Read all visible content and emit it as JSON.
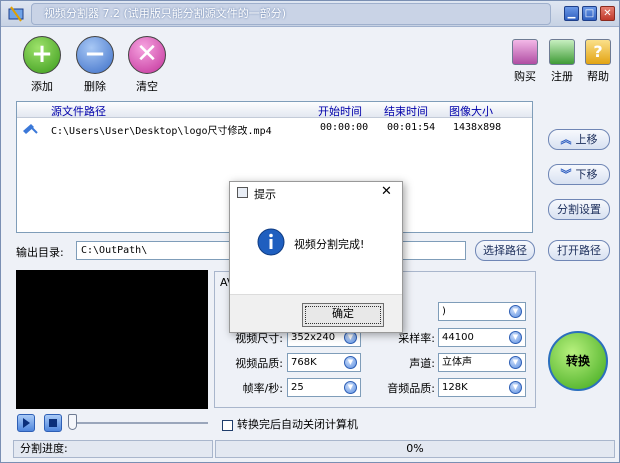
{
  "window": {
    "title": "视频分割器 7.2 (试用版只能分割源文件的一部分)"
  },
  "toolbar": {
    "add_label": "添加",
    "delete_label": "删除",
    "clear_label": "清空",
    "buy_label": "购买",
    "register_label": "注册",
    "help_label": "帮助"
  },
  "filelist": {
    "headers": [
      "源文件路径",
      "开始时间",
      "结束时间",
      "图像大小"
    ],
    "rows": [
      {
        "path": "C:\\Users\\User\\Desktop\\logo尺寸修改.mp4",
        "start": "00:00:00",
        "end": "00:01:54",
        "size": "1438x898"
      }
    ]
  },
  "side": {
    "up_label": "上移",
    "down_label": "下移",
    "split_settings_label": "分割设置"
  },
  "output": {
    "label": "输出目录:",
    "path": "C:\\OutPath\\",
    "browse_label": "选择路径",
    "open_label": "打开路径"
  },
  "settings": {
    "panel_label": "AV",
    "video_size_label": "视频尺寸:",
    "video_size_value": "352x240",
    "video_quality_label": "视频品质:",
    "video_quality_value": "768K",
    "fps_label": "帧率/秒:",
    "fps_value": "25",
    "format_value": ")",
    "sample_rate_label": "采样率:",
    "sample_rate_value": "44100",
    "channel_label": "声道:",
    "channel_value": "立体声",
    "audio_quality_label": "音频品质:",
    "audio_quality_value": "128K"
  },
  "convert_label": "转换",
  "shutdown_label": "转换完后自动关闭计算机",
  "status": {
    "progress_label": "分割进度:",
    "progress_text": "0%",
    "progress_value": 0
  },
  "dialog": {
    "title": "提示",
    "message": "视频分割完成!",
    "ok_label": "确定"
  },
  "colors": {
    "accent": "#2d5dc0",
    "convert_green": "#3ca61a"
  },
  "icons": [
    "app-icon",
    "add-icon",
    "delete-icon",
    "clear-icon",
    "cart-icon",
    "register-icon",
    "help-icon",
    "video-file-icon",
    "arrow-up-icon",
    "arrow-down-icon",
    "info-icon",
    "close-icon",
    "play-icon",
    "stop-icon"
  ]
}
